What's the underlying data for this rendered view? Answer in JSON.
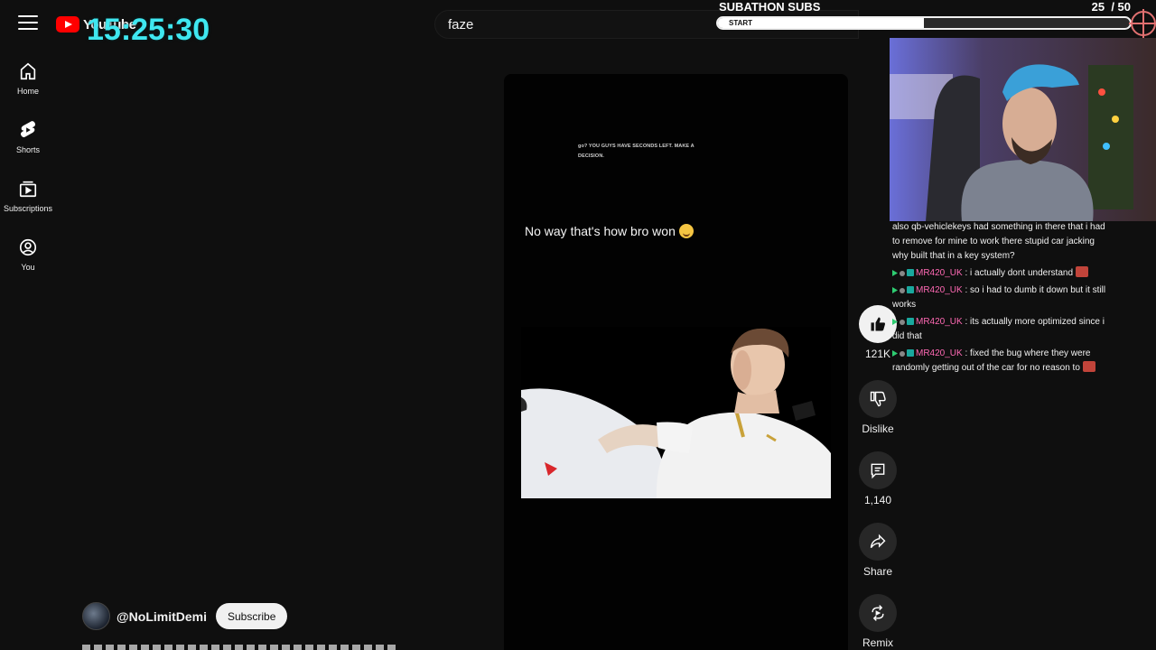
{
  "header": {
    "logo_text": "YouTube",
    "search_value": "faze",
    "stream_clock": "15:25:30"
  },
  "sidebar": {
    "items": [
      {
        "label": "Home",
        "icon": "home-icon"
      },
      {
        "label": "Shorts",
        "icon": "shorts-icon"
      },
      {
        "label": "Subscriptions",
        "icon": "subscriptions-icon"
      },
      {
        "label": "You",
        "icon": "account-icon"
      }
    ]
  },
  "video": {
    "top_caption": "go? YOU GUYS HAVE SECONDS LEFT. MAKE A DECISION.",
    "main_caption": "No way that's how bro won"
  },
  "actions": {
    "like_count": "121K",
    "dislike_label": "Dislike",
    "comment_count": "1,140",
    "share_label": "Share",
    "remix_label": "Remix"
  },
  "channel": {
    "handle": "@NoLimitDemi",
    "subscribe_label": "Subscribe"
  },
  "subathon": {
    "title": "SUBATHON SUBS",
    "count": "25",
    "goal": "/ 50",
    "bar_label": "START",
    "progress": 0.5
  },
  "chat": [
    {
      "user": "",
      "text": "also qb-vehiclekeys had something in there that i had to remove for mine to work there stupid car jacking why built that in a key system?"
    },
    {
      "user": "MR420_UK",
      "text": "i actually dont understand"
    },
    {
      "user": "MR420_UK",
      "text": "so i had to dumb it down but it still works"
    },
    {
      "user": "MR420_UK",
      "text": "its actually more optimized since i did that"
    },
    {
      "user": "MR420_UK",
      "text": "fixed the bug where they were randomly getting out of the car for no reason to"
    }
  ],
  "colors": {
    "accent_clock": "#3fe7f0",
    "chat_username": "#ff69b4",
    "youtube_red": "#ff0000"
  }
}
